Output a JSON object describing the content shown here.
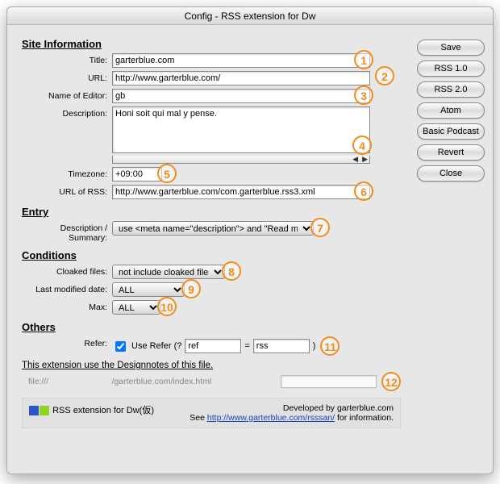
{
  "window": {
    "title": "Config - RSS extension for Dw"
  },
  "sidebar": {
    "save": "Save",
    "rss10": "RSS 1.0",
    "rss20": "RSS 2.0",
    "atom": "Atom",
    "podcast": "Basic Podcast",
    "revert": "Revert",
    "close": "Close"
  },
  "sections": {
    "site": "Site Information",
    "entry": "Entry",
    "conditions": "Conditions",
    "others": "Others"
  },
  "labels": {
    "title": "Title:",
    "url": "URL:",
    "editor": "Name of Editor:",
    "description": "Description:",
    "timezone": "Timezone:",
    "rssurl": "URL of RSS:",
    "descsummary": "Description / Summary:",
    "cloaked": "Cloaked files:",
    "lastmod": "Last modified date:",
    "max": "Max:",
    "refer": "Refer:"
  },
  "values": {
    "title": "garterblue.com",
    "url": "http://www.garterblue.com/",
    "editor": "gb",
    "description": "Honi soit qui mal y pense.",
    "timezone": "+09:00",
    "rssurl": "http://www.garterblue.com/com.garterblue.rss3.xml",
    "descsummary": "use <meta name=\"description\"> and \"Read more ...\"",
    "cloaked": "not include cloaked files",
    "lastmod": "ALL",
    "max": "ALL",
    "use_refer_label": "Use Refer (?",
    "refer_key": "ref",
    "refer_eq": "=",
    "refer_val": "rss",
    "refer_close": ")"
  },
  "designnotes": {
    "heading": "This extension use the Designnotes of this file.",
    "protocol": "file:///",
    "path": "/garterblue.com/index.html"
  },
  "footer": {
    "product": "RSS extension for Dw(仮)",
    "dev": "Developed by garterblue.com",
    "see_pre": "See ",
    "link": "http://www.garterblue.com/rsssan/",
    "see_post": " for information."
  },
  "badges": [
    "1",
    "2",
    "3",
    "4",
    "5",
    "6",
    "7",
    "8",
    "9",
    "10",
    "11",
    "12"
  ]
}
